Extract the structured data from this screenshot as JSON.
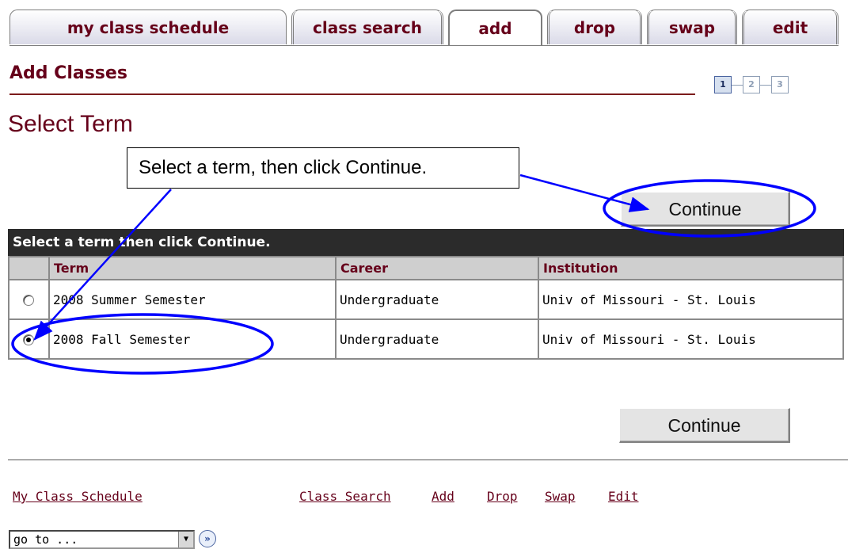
{
  "tabs": [
    {
      "label": "my class schedule"
    },
    {
      "label": "class search"
    },
    {
      "label": "add"
    },
    {
      "label": "drop"
    },
    {
      "label": "swap"
    },
    {
      "label": "edit"
    }
  ],
  "page": {
    "title": "Add Classes",
    "section_title": "Select Term",
    "steps": [
      "1",
      "2",
      "3"
    ]
  },
  "callout": {
    "text": "Select a term, then click Continue."
  },
  "buttons": {
    "continue_top": "Continue",
    "continue_bottom": "Continue"
  },
  "table": {
    "caption": "Select a term then click Continue.",
    "headers": [
      "Term",
      "Career",
      "Institution"
    ],
    "rows": [
      {
        "term": "2008 Summer Semester",
        "career": "Undergraduate",
        "institution": "Univ of Missouri - St. Louis",
        "selected": false
      },
      {
        "term": "2008 Fall Semester",
        "career": "Undergraduate",
        "institution": "Univ of Missouri - St. Louis",
        "selected": true
      }
    ]
  },
  "footer": {
    "links": [
      "My Class Schedule",
      "Class Search",
      "Add",
      "Drop",
      "Swap",
      "Edit"
    ],
    "goto_value": "go to ...",
    "go_icon": "double-chevron-right-icon"
  },
  "colors": {
    "accent": "#66001a",
    "annotation": "#0000ff",
    "table_header_dark": "#2b2b2b"
  }
}
